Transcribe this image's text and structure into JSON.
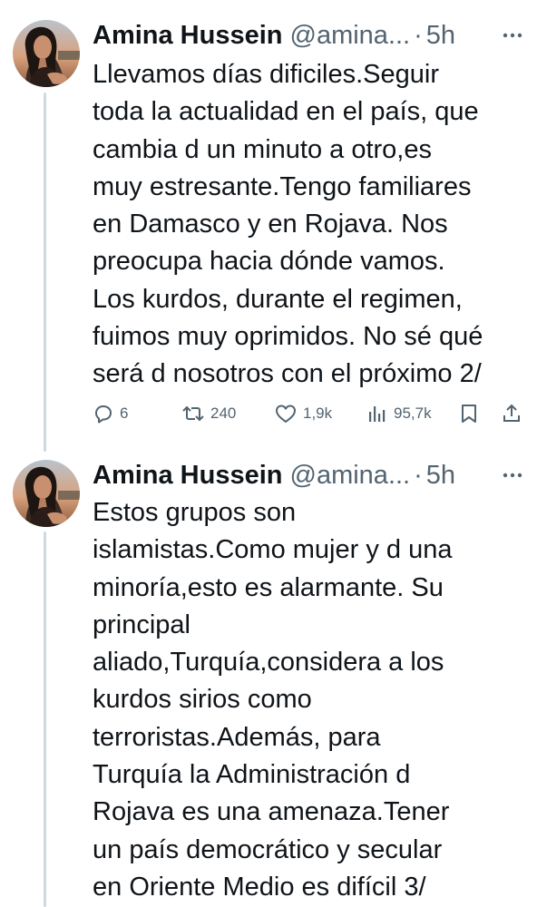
{
  "colors": {
    "text": "#0f1419",
    "muted": "#536471",
    "thread_line": "#cfd9de",
    "background": "#ffffff"
  },
  "tweets": [
    {
      "author_name": "Amina Hussein",
      "handle": "@amina",
      "handle_ellipsis": "...",
      "separator": "·",
      "time": "5h",
      "more_icon": "more-horizontal-icon",
      "lines": [
        "Llevamos días dificiles.Seguir",
        "toda la actualidad en el país, que",
        "cambia d un minuto a otro,es",
        "muy estresante.Tengo familiares",
        "en Damasco y en Rojava. Nos",
        "preocupa hacia dónde vamos.",
        "Los kurdos, durante el regimen,",
        "fuimos muy oprimidos. No sé qué",
        "será d nosotros con el próximo 2/"
      ],
      "stats": {
        "replies": "6",
        "retweets": "240",
        "likes": "1,9k",
        "views": "95,7k"
      }
    },
    {
      "author_name": "Amina Hussein",
      "handle": "@amina",
      "handle_ellipsis": "...",
      "separator": "·",
      "time": "5h",
      "more_icon": "more-horizontal-icon",
      "lines": [
        "Estos grupos son",
        "islamistas.Como mujer y d una",
        "minoría,esto es alarmante. Su",
        "principal",
        "aliado,Turquía,considera a los",
        "kurdos sirios como",
        "terroristas.Además, para",
        "Turquía la Administración d",
        "Rojava es una amenaza.Tener",
        "un país democrático y secular",
        "en Oriente Medio es difícil 3/"
      ]
    }
  ]
}
